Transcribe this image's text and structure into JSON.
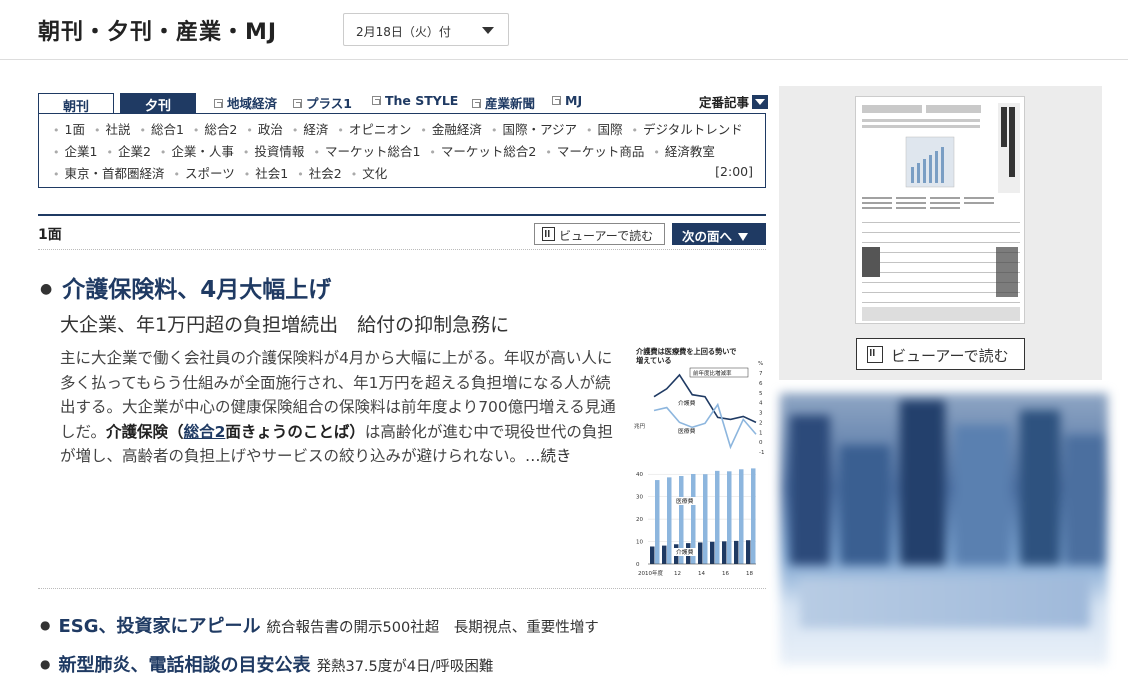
{
  "header": {
    "title": "朝刊・夕刊・産業・MJ",
    "date_label": "2月18日（火）付"
  },
  "tabs": {
    "chokan": "朝刊",
    "yukan": "夕刊"
  },
  "links": [
    {
      "label": "地域経済"
    },
    {
      "label": "プラス1"
    },
    {
      "label": "The STYLE"
    },
    {
      "label": "産業新聞"
    },
    {
      "label": "MJ"
    }
  ],
  "teiban": "定番記事",
  "sections": [
    "1面",
    "社説",
    "総合1",
    "総合2",
    "政治",
    "経済",
    "オピニオン",
    "金融経済",
    "国際・アジア",
    "国際",
    "デジタルトレンド",
    "企業1",
    "企業2",
    "企業・人事",
    "投資情報",
    "マーケット総合1",
    "マーケット総合2",
    "マーケット商品",
    "経済教室",
    "東京・首都圏経済",
    "スポーツ",
    "社会1",
    "社会2",
    "文化"
  ],
  "timestamp": "[2:00]",
  "page": {
    "label": "1面",
    "viewer_button": "ビューアーで読む",
    "next_button": "次の面へ"
  },
  "main_article": {
    "headline": "介護保険料、4月大幅上げ",
    "subhead": "大企業、年1万円超の負担増続出　給付の抑制急務に",
    "lead_1": "主に大企業で働く会社員の介護保険料が4月から大幅に上がる。年収が高い人に多く払ってもらう仕組みが全面施行され、年1万円を超える負担増になる人が続出する。大企業が中心の健康保険組合の保険料は前年度より700億円増える見通しだ。",
    "keyword": "介護保険（",
    "keyword_link": "総合2",
    "keyword_suffix": "面きょうのことば）",
    "lead_2": "は高齢化が進む中で現役世代の負担が増し、高齢者の負担上げやサービスの絞り込みが避けられない。",
    "continue": "…続き"
  },
  "chart_data": {
    "type": "bar",
    "title": "介護費は医療費を上回る勢いで増えている",
    "inset_title": "前年度比増減率",
    "right_unit": "%",
    "left_unit": "兆円",
    "x": [
      "2010年度",
      "",
      "12",
      "",
      "14",
      "",
      "16",
      "",
      "18"
    ],
    "series": [
      {
        "name": "医療費",
        "values": [
          37.4,
          38.6,
          39.2,
          40.1,
          40.0,
          41.5,
          41.3,
          42.2,
          42.6
        ]
      },
      {
        "name": "介護費",
        "values": [
          7.8,
          8.2,
          8.8,
          9.3,
          9.6,
          9.9,
          10.1,
          10.3,
          10.6
        ]
      }
    ],
    "growth_series": [
      {
        "name": "介護費",
        "values": [
          4.6,
          5.4,
          6.8,
          4.8,
          4.6,
          2.5,
          2.3,
          2.6,
          2.0
        ]
      },
      {
        "name": "医療費",
        "values": [
          3.2,
          3.5,
          2.0,
          1.5,
          1.9,
          3.8,
          -0.5,
          2.3,
          0.8
        ]
      }
    ],
    "yticks_left": [
      "0",
      "10",
      "20",
      "30",
      "40"
    ],
    "yticks_right": [
      "7",
      "6",
      "5",
      "4",
      "3",
      "2",
      "1",
      "0",
      "-1"
    ],
    "ylim": [
      0,
      45
    ],
    "growth_ylim": [
      -1,
      7
    ]
  },
  "articles": [
    {
      "title": "ESG、投資家にアピール",
      "sub": "統合報告書の開示500社超　長期視点、重要性増す"
    },
    {
      "title": "新型肺炎、電話相談の目安公表",
      "sub": "発熱37.5度が4日/呼吸困難"
    }
  ],
  "sidebar": {
    "viewer_button": "ビューアーで読む"
  },
  "colors": {
    "navy": "#1f3a63",
    "bar_light": "#8db6de",
    "bar_dark": "#1f3a63"
  }
}
